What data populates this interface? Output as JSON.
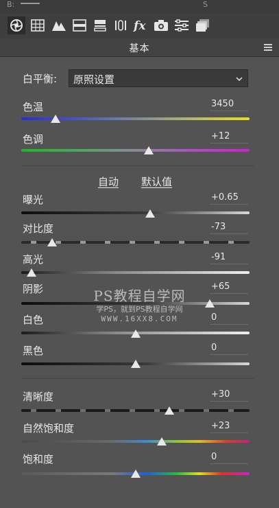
{
  "topbar": {
    "left_char": "B:",
    "fragment": "S"
  },
  "toolbar": {
    "tools": [
      "basic-icon",
      "tone-curve-icon",
      "detail-icon",
      "hsl-icon",
      "split-toning-icon",
      "lens-corrections-icon",
      "fx-icon",
      "camera-calibration-icon",
      "presets-icon",
      "snapshots-icon"
    ]
  },
  "panel": {
    "title": "基本"
  },
  "white_balance": {
    "label": "白平衡:",
    "value": "原照设置"
  },
  "sliders": {
    "temperature": {
      "label": "色温",
      "value": "3450",
      "position": 0.15
    },
    "tint": {
      "label": "色调",
      "value": "+12",
      "position": 0.56
    },
    "exposure": {
      "label": "曝光",
      "value": "+0.65",
      "position": 0.565
    },
    "contrast": {
      "label": "对比度",
      "value": "-73",
      "position": 0.135
    },
    "highlights": {
      "label": "高光",
      "value": "-91",
      "position": 0.045
    },
    "shadows": {
      "label": "阴影",
      "value": "+65",
      "position": 0.825
    },
    "whites": {
      "label": "白色",
      "value": "0",
      "position": 0.5
    },
    "blacks": {
      "label": "黑色",
      "value": "0",
      "position": 0.5
    },
    "clarity": {
      "label": "清晰度",
      "value": "+30",
      "position": 0.65
    },
    "vibrance": {
      "label": "自然饱和度",
      "value": "+23",
      "position": 0.615
    },
    "saturation": {
      "label": "饱和度",
      "value": "0",
      "position": 0.5
    }
  },
  "tone": {
    "auto": "自动",
    "default": "默认值"
  },
  "watermark": {
    "line1": "PS教程自学网",
    "line2": "学PS，就到PS教程自学网",
    "line3": "WWW.16XX8.COM"
  },
  "colors": {
    "background": "#535353",
    "thumb": "#e8e8e8"
  }
}
